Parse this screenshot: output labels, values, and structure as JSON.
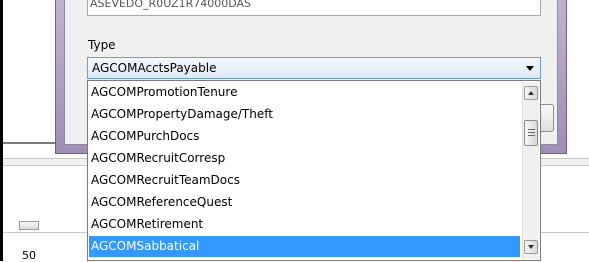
{
  "top_field": {
    "value": "ASEVEDO_R0UZ1R74000DAS"
  },
  "type_label": "Type",
  "type_combo": {
    "selected": "AGCOMAcctsPayable"
  },
  "dropdown": {
    "items": [
      {
        "label": "AGCOMPromotionTenure",
        "selected": false
      },
      {
        "label": "AGCOMPropertyDamage/Theft",
        "selected": false
      },
      {
        "label": "AGCOMPurchDocs",
        "selected": false
      },
      {
        "label": "AGCOMRecruitCorresp",
        "selected": false
      },
      {
        "label": "AGCOMRecruitTeamDocs",
        "selected": false
      },
      {
        "label": "AGCOMReferenceQuest",
        "selected": false
      },
      {
        "label": "AGCOMRetirement",
        "selected": false
      },
      {
        "label": "AGCOMSabbatical",
        "selected": true
      }
    ]
  },
  "background": {
    "number": "50"
  },
  "colors": {
    "selection": "#3399ff",
    "dialog_frame": "#9d8fb3",
    "combo_border": "#6f9bd0"
  },
  "icons": [
    "chevron-down-icon",
    "scroll-up-icon",
    "scroll-down-icon"
  ]
}
